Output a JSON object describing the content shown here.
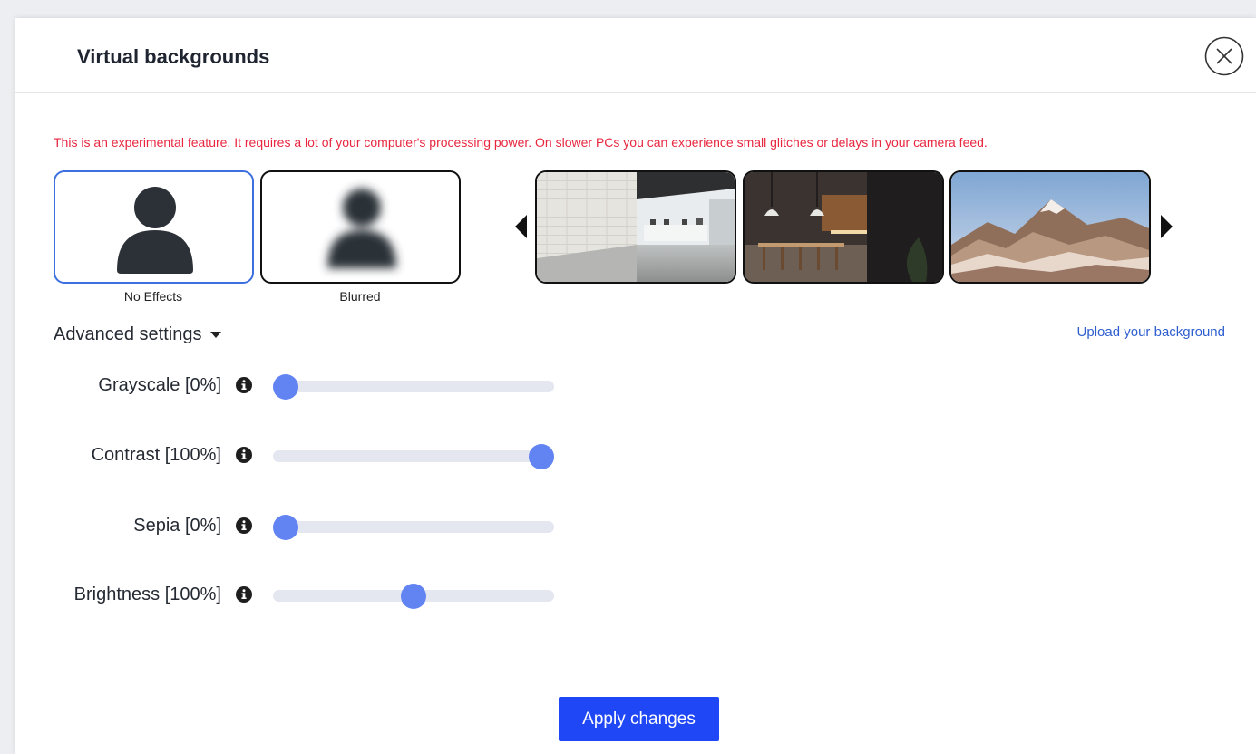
{
  "modal": {
    "title": "Virtual backgrounds",
    "warning": "This is an experimental feature. It requires a lot of your computer's processing power. On slower PCs you can experience small glitches or delays in your camera feed."
  },
  "effects": [
    {
      "label": "No Effects",
      "selected": true
    },
    {
      "label": "Blurred",
      "selected": false
    }
  ],
  "backgrounds": [
    "office",
    "kitchen",
    "mountains"
  ],
  "advanced_settings_label": "Advanced settings",
  "upload_label": "Upload your background",
  "settings": [
    {
      "label": "Grayscale [0%]",
      "value": 0
    },
    {
      "label": "Contrast [100%]",
      "value": 100
    },
    {
      "label": "Sepia [0%]",
      "value": 0
    },
    {
      "label": "Brightness [100%]",
      "value": 50
    }
  ],
  "apply_label": "Apply changes",
  "colors": {
    "accent": "#1f47f5",
    "warning": "#e8273f",
    "slider_knob": "#6283f2",
    "link": "#2f5fcf"
  }
}
